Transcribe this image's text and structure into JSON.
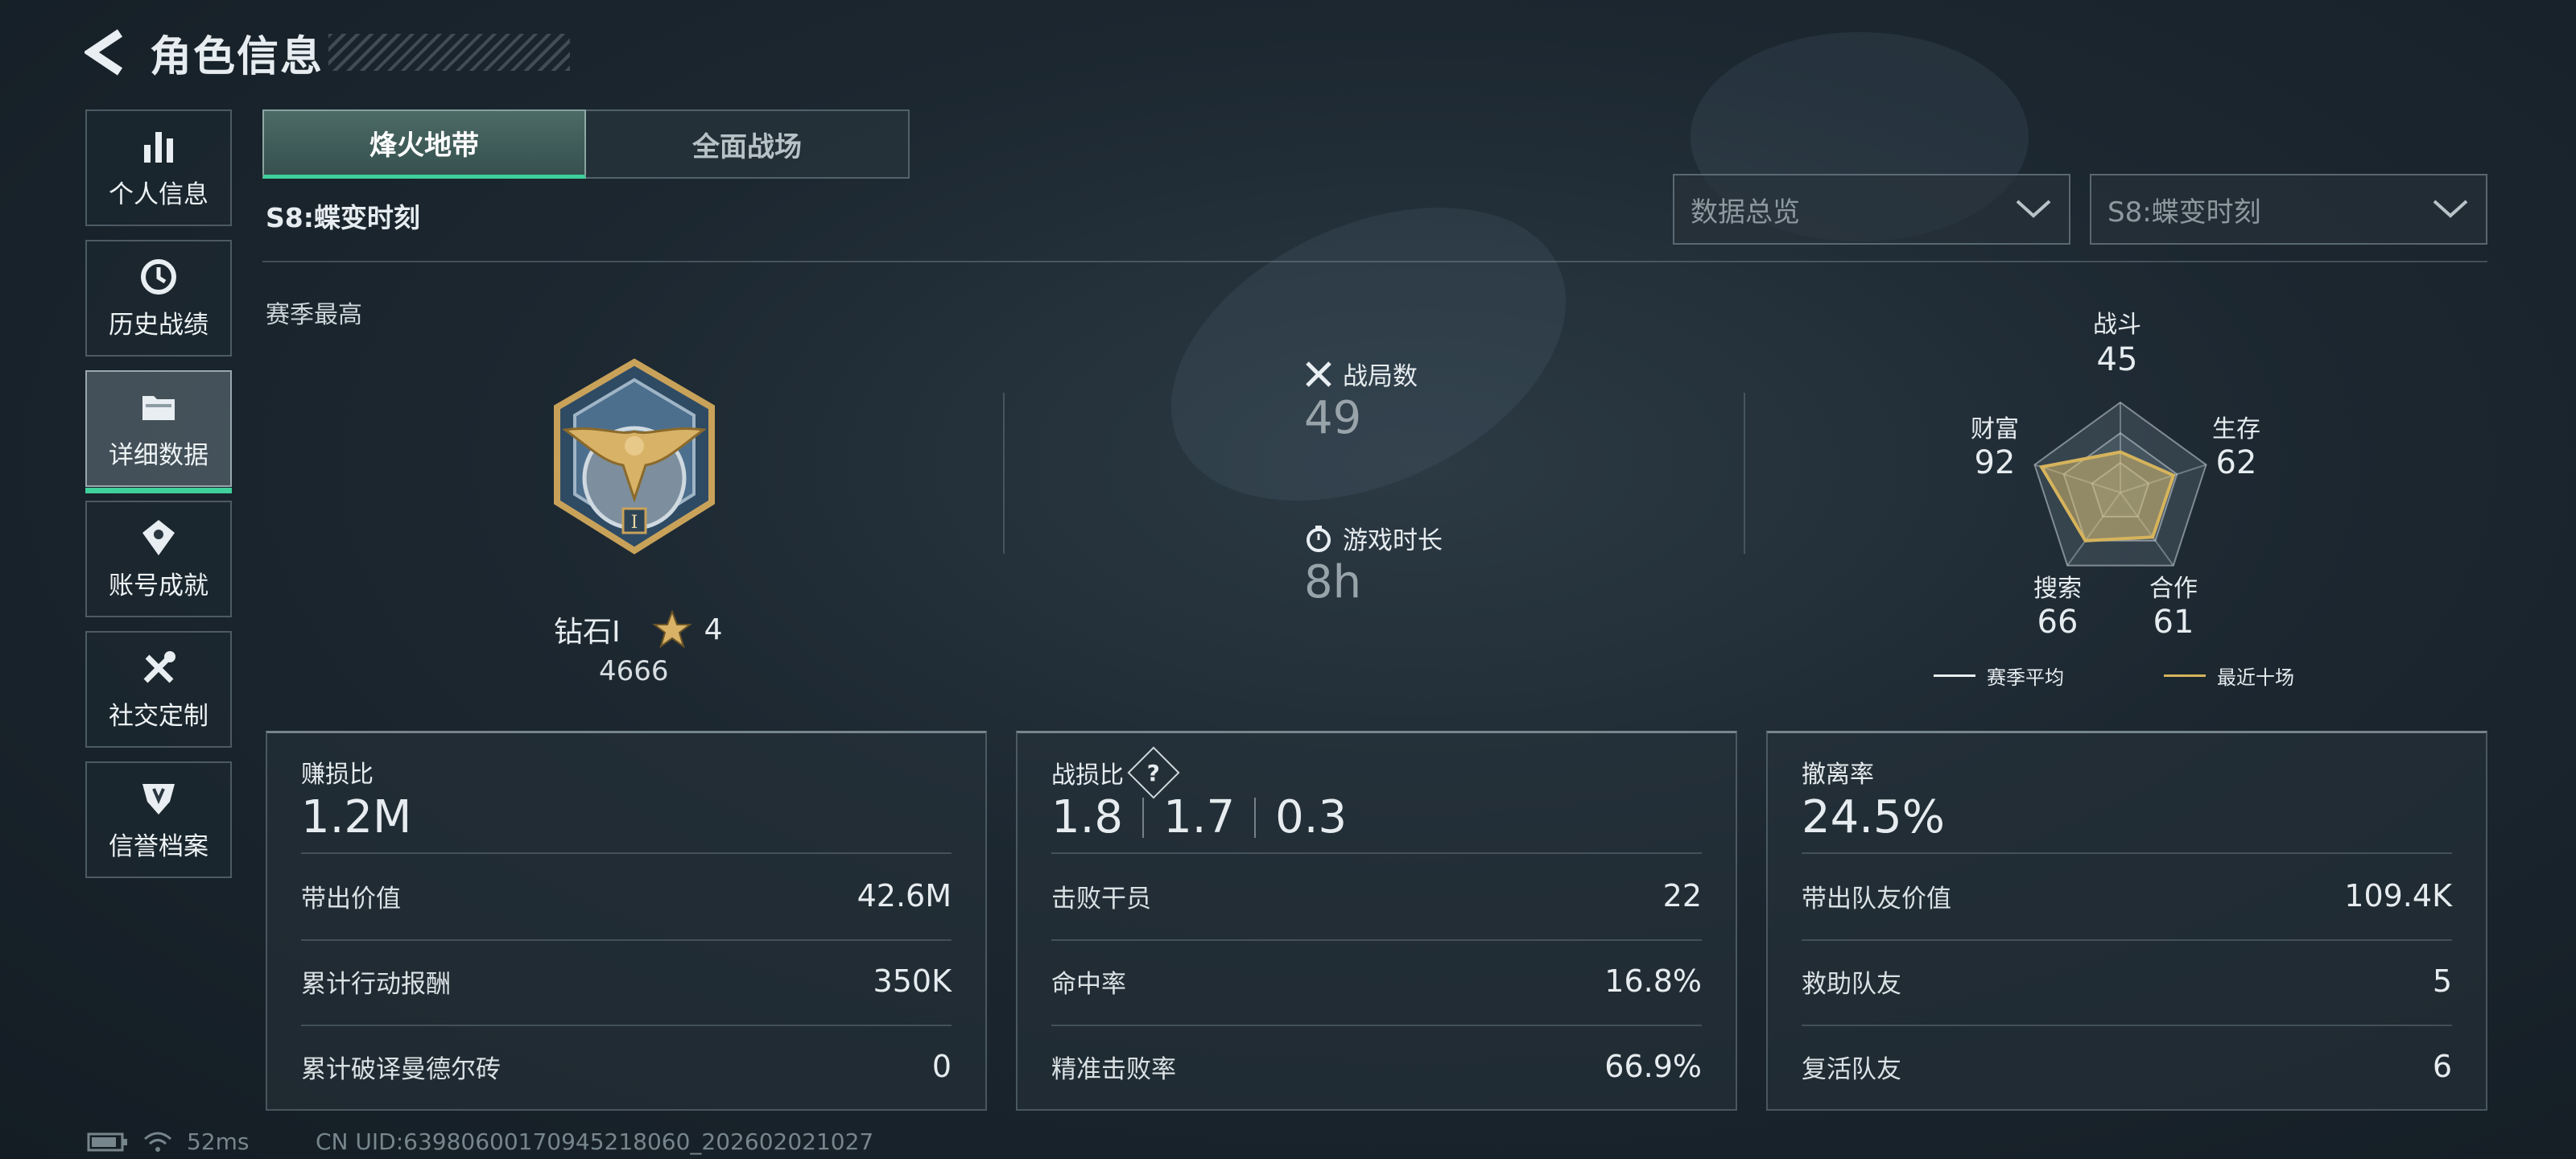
{
  "header": {
    "title": "角色信息"
  },
  "sidebar": {
    "items": [
      {
        "label": "个人信息",
        "icon": "bar-chart-icon"
      },
      {
        "label": "历史战绩",
        "icon": "history-clock-icon"
      },
      {
        "label": "详细数据",
        "icon": "folder-icon",
        "active": true
      },
      {
        "label": "账号成就",
        "icon": "achievement-icon"
      },
      {
        "label": "社交定制",
        "icon": "tools-icon"
      },
      {
        "label": "信誉档案",
        "icon": "credit-shield-icon"
      }
    ]
  },
  "tabs": [
    {
      "label": "烽火地带",
      "active": true
    },
    {
      "label": "全面战场",
      "active": false
    }
  ],
  "season_label": "S8:蝶变时刻",
  "dropdowns": {
    "view": {
      "value": "数据总览"
    },
    "season": {
      "value": "S8:蝶变时刻"
    }
  },
  "season_best": {
    "label": "赛季最高",
    "rank_name": "钻石Ⅰ",
    "stars": "4",
    "score": "4666"
  },
  "stats": {
    "matches": {
      "label": "战局数",
      "value": "49"
    },
    "playtime": {
      "label": "游戏时长",
      "value": "8h"
    }
  },
  "radar": {
    "axes": [
      {
        "label": "战斗",
        "value": 45
      },
      {
        "label": "生存",
        "value": 62
      },
      {
        "label": "合作",
        "value": 61
      },
      {
        "label": "搜索",
        "value": 66
      },
      {
        "label": "财富",
        "value": 92
      }
    ],
    "legend": {
      "season_avg": "赛季平均",
      "recent_ten": "最近十场"
    },
    "colors": {
      "season_avg": "#e9eef0",
      "recent_ten": "#d6b45c"
    }
  },
  "panels": {
    "profit": {
      "title": "赚损比",
      "value": "1.2M",
      "rows": [
        {
          "label": "带出价值",
          "value": "42.6M"
        },
        {
          "label": "累计行动报酬",
          "value": "350K"
        },
        {
          "label": "累计破译曼德尔砖",
          "value": "0"
        }
      ]
    },
    "kd": {
      "title": "战损比",
      "help": "?",
      "values": [
        "1.8",
        "1.7",
        "0.3"
      ],
      "rows": [
        {
          "label": "击败干员",
          "value": "22"
        },
        {
          "label": "命中率",
          "value": "16.8%"
        },
        {
          "label": "精准击败率",
          "value": "66.9%"
        }
      ]
    },
    "extract": {
      "title": "撤离率",
      "value": "24.5%",
      "rows": [
        {
          "label": "带出队友价值",
          "value": "109.4K"
        },
        {
          "label": "救助队友",
          "value": "5"
        },
        {
          "label": "复活队友",
          "value": "6"
        }
      ]
    }
  },
  "footer": {
    "ping": "52ms",
    "uid": "CN UID:63980600170945218060_202602021027"
  },
  "colors": {
    "accent": "#3fd09b",
    "gold": "#d6b45c"
  }
}
